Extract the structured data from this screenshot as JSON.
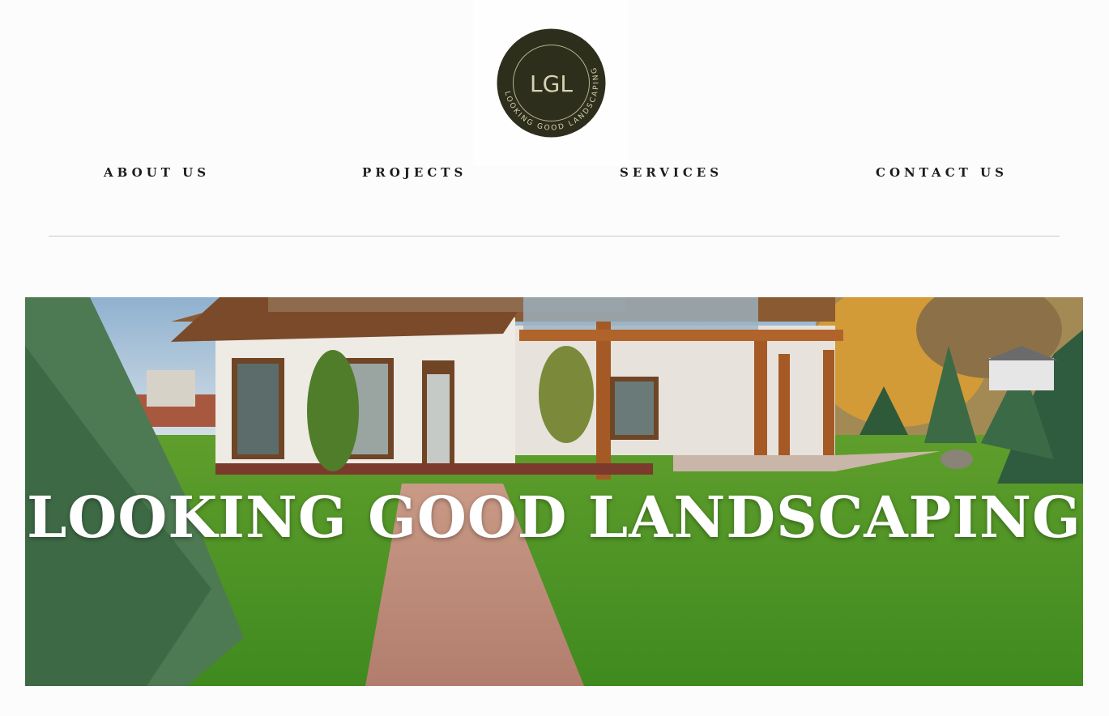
{
  "logo": {
    "monogram": "LGL",
    "ring_text": "LOOKING GOOD LANDSCAPING",
    "background": "#2d2e1c",
    "accent": "#d8d2b0"
  },
  "nav": {
    "items": [
      {
        "label": "ABOUT US"
      },
      {
        "label": "PROJECTS"
      },
      {
        "label": "SERVICES"
      },
      {
        "label": "CONTACT US"
      }
    ]
  },
  "hero": {
    "title": "LOOKING GOOD LANDSCAPING",
    "image_subject": "house-with-lawn-and-brick-path"
  },
  "colors": {
    "nav_text": "#1c1c1c",
    "divider": "#c9c9c9",
    "hero_title": "#ffffff"
  }
}
